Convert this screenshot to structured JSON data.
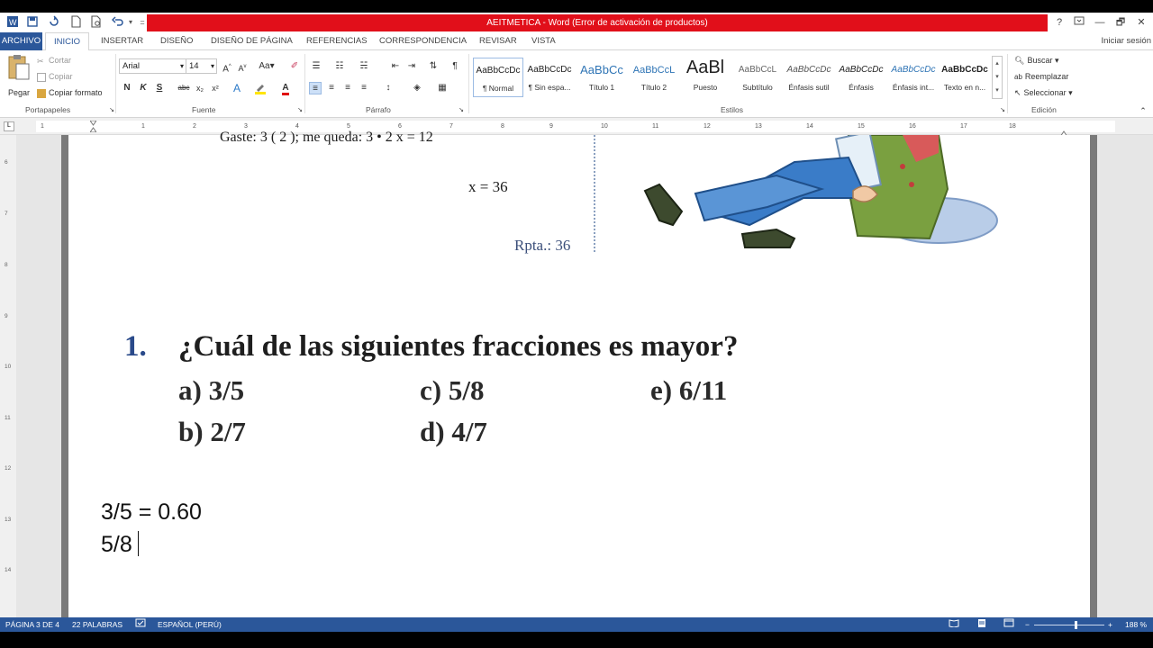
{
  "window": {
    "title": "AEITMETICA -  Word (Error de activación de productos)",
    "help": "?",
    "minimize": "—",
    "restore": "🗗",
    "close": "✕"
  },
  "tabs": [
    "ARCHIVO",
    "INICIO",
    "INSERTAR",
    "DISEÑO",
    "DISEÑO DE PÁGINA",
    "REFERENCIAS",
    "CORRESPONDENCIA",
    "REVISAR",
    "VISTA"
  ],
  "signin": "Iniciar sesión",
  "clipboard": {
    "paste": "Pegar",
    "cut": "Cortar",
    "copy": "Copiar",
    "format_painter": "Copiar formato",
    "group": "Portapapeles"
  },
  "font": {
    "family": "Arial",
    "size": "14",
    "group": "Fuente",
    "bold": "N",
    "italic": "K",
    "underline": "S",
    "strike": "abc",
    "subscript": "x₂",
    "superscript": "x²"
  },
  "paragraph": {
    "group": "Párrafo"
  },
  "styles": {
    "group": "Estilos",
    "items": [
      {
        "preview": "AaBbCcDc",
        "name": "¶ Normal"
      },
      {
        "preview": "AaBbCcDc",
        "name": "¶ Sin espa..."
      },
      {
        "preview": "AaBbCc",
        "name": "Título 1"
      },
      {
        "preview": "AaBbCcL",
        "name": "Título 2"
      },
      {
        "preview": "AaBl",
        "name": "Puesto"
      },
      {
        "preview": "AaBbCcL",
        "name": "Subtítulo"
      },
      {
        "preview": "AaBbCcDc",
        "name": "Énfasis sutil"
      },
      {
        "preview": "AaBbCcDc",
        "name": "Énfasis"
      },
      {
        "preview": "AaBbCcDc",
        "name": "Énfasis int..."
      },
      {
        "preview": "AaBbCcDc",
        "name": "Texto en n..."
      }
    ]
  },
  "editing": {
    "group": "Edición",
    "find": "Buscar",
    "replace": "Reemplazar",
    "select": "Seleccionar"
  },
  "ruler_numbers": [
    "1",
    "1",
    "2",
    "3",
    "4",
    "5",
    "6",
    "7",
    "8",
    "9",
    "10",
    "11",
    "12",
    "13",
    "14",
    "15",
    "16",
    "17",
    "18"
  ],
  "vruler_numbers": [
    "6",
    "7",
    "8",
    "9",
    "10",
    "11",
    "12",
    "13",
    "14"
  ],
  "document": {
    "example_top": "Gaste: 3 ( 2 ); me queda: 3 • 2  x = 12",
    "example_x": "x = 36",
    "example_rpta": "Rpta.:  36",
    "question_number": "1.",
    "question_text": "¿Cuál de las siguientes fracciones es mayor?",
    "options": {
      "a": "a) 3/5",
      "b": "b) 2/7",
      "c": "c)  5/8",
      "d": "d)  4/7",
      "e": "e)  6/11"
    },
    "typed_line_1": "3/5 = 0.60",
    "typed_line_2": "5/8"
  },
  "status": {
    "page": "PÁGINA 3 DE 4",
    "words": "22 PALABRAS",
    "language": "ESPAÑOL (PERÚ)",
    "zoom": "188 %"
  }
}
